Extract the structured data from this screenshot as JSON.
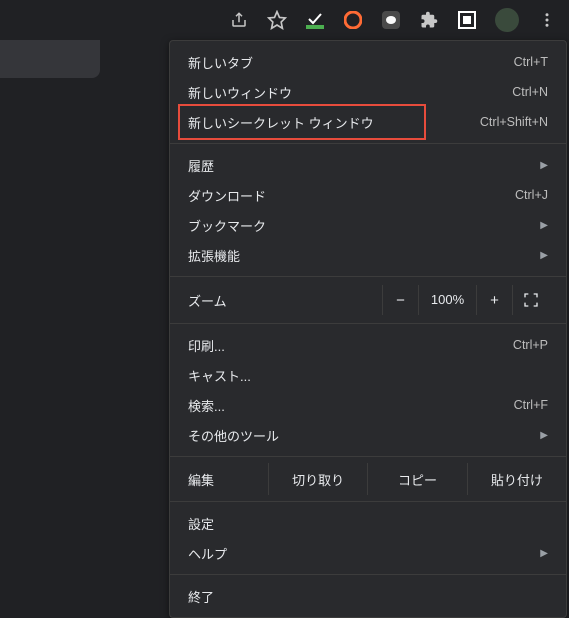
{
  "toolbar": {
    "share": "share-icon",
    "star": "star-icon",
    "ext1": "checkmark-icon",
    "ext2": "orange-icon",
    "ext3": "line-icon",
    "ext4": "puzzle-icon",
    "ext5": "square-icon"
  },
  "menu": {
    "new_tab": {
      "label": "新しいタブ",
      "shortcut": "Ctrl+T"
    },
    "new_window": {
      "label": "新しいウィンドウ",
      "shortcut": "Ctrl+N"
    },
    "incognito": {
      "label": "新しいシークレット ウィンドウ",
      "shortcut": "Ctrl+Shift+N"
    },
    "history": {
      "label": "履歴"
    },
    "downloads": {
      "label": "ダウンロード",
      "shortcut": "Ctrl+J"
    },
    "bookmarks": {
      "label": "ブックマーク"
    },
    "extensions": {
      "label": "拡張機能"
    },
    "zoom": {
      "label": "ズーム",
      "value": "100%",
      "minus": "−",
      "plus": "+"
    },
    "print": {
      "label": "印刷...",
      "shortcut": "Ctrl+P"
    },
    "cast": {
      "label": "キャスト..."
    },
    "find": {
      "label": "検索...",
      "shortcut": "Ctrl+F"
    },
    "more_tools": {
      "label": "その他のツール"
    },
    "edit": {
      "label": "編集",
      "cut": "切り取り",
      "copy": "コピー",
      "paste": "貼り付け"
    },
    "settings": {
      "label": "設定"
    },
    "help": {
      "label": "ヘルプ"
    },
    "exit": {
      "label": "終了"
    }
  }
}
